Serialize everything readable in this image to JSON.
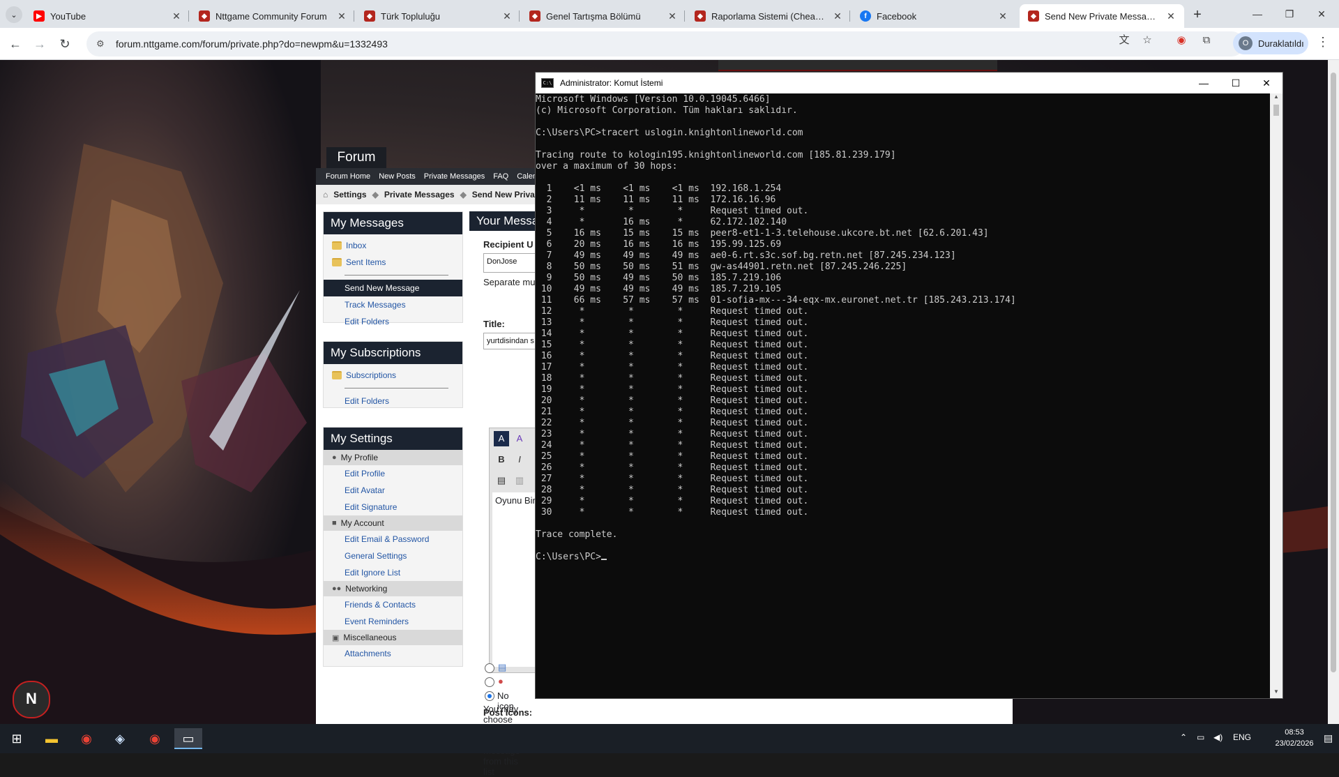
{
  "browser": {
    "tabs": [
      {
        "title": "YouTube",
        "icon": "youtube-icon",
        "color": "#ff0000"
      },
      {
        "title": "Nttgame Community Forum",
        "icon": "nttgame-icon",
        "color": "#b3261e"
      },
      {
        "title": "Türk Topluluğu",
        "icon": "nttgame-icon",
        "color": "#b3261e"
      },
      {
        "title": "Genel Tartışma Bölümü",
        "icon": "nttgame-icon",
        "color": "#b3261e"
      },
      {
        "title": "Raporlama Sistemi (Cheat Repo",
        "icon": "nttgame-icon",
        "color": "#b3261e"
      },
      {
        "title": "Facebook",
        "icon": "facebook-icon",
        "color": "#1877f2"
      },
      {
        "title": "Send New Private Message - N",
        "icon": "nttgame-icon",
        "color": "#b3261e",
        "active": true
      }
    ],
    "url": "forum.nttgame.com/forum/private.php?do=newpm&u=1332493",
    "profile_initial": "O",
    "profile_label": "Duraklatıldı"
  },
  "forum": {
    "tab_label": "Forum",
    "nav": [
      "Forum Home",
      "New Posts",
      "Private Messages",
      "FAQ",
      "Calenda"
    ],
    "breadcrumb": [
      "Settings",
      "Private Messages",
      "Send New Privat"
    ],
    "my_messages": {
      "title": "My Messages",
      "folders": [
        "Inbox",
        "Sent Items"
      ],
      "links": [
        "Send New Message",
        "Track Messages",
        "Edit Folders"
      ]
    },
    "my_subscriptions": {
      "title": "My Subscriptions",
      "folders": [
        "Subscriptions"
      ],
      "links": [
        "Edit Folders"
      ]
    },
    "my_settings": {
      "title": "My Settings",
      "groups": [
        {
          "label": "My Profile",
          "links": [
            "Edit Profile",
            "Edit Avatar",
            "Edit Signature"
          ]
        },
        {
          "label": "My Account",
          "links": [
            "Edit Email & Password",
            "General Settings",
            "Edit Ignore List"
          ]
        },
        {
          "label": "Networking",
          "links": [
            "Friends & Contacts",
            "Event Reminders"
          ]
        },
        {
          "label": "Miscellaneous",
          "links": [
            "Attachments"
          ]
        }
      ]
    },
    "compose": {
      "header": "Your Messa",
      "recipient_label": "Recipient U",
      "recipient_value": "DonJose",
      "separate_text": "Separate mu",
      "title_label": "Title:",
      "title_value": "yurtdisindan s",
      "body_text": "Oyunu Birl",
      "post_icons_label": "Post Icons:",
      "no_icon_label": "No icon",
      "icons_hint": "You may choose an icon for your message from this list"
    }
  },
  "cmd": {
    "title": "Administrator: Komut İstemi",
    "lines": [
      "Microsoft Windows [Version 10.0.19045.6466]",
      "(c) Microsoft Corporation. Tüm hakları saklıdır.",
      "",
      "C:\\Users\\PC>tracert uslogin.knightonlineworld.com",
      "",
      "Tracing route to kologin195.knightonlineworld.com [185.81.239.179]",
      "over a maximum of 30 hops:",
      "",
      "  1    <1 ms    <1 ms    <1 ms  192.168.1.254",
      "  2    11 ms    11 ms    11 ms  172.16.16.96",
      "  3     *        *        *     Request timed out.",
      "  4     *       16 ms     *     62.172.102.140",
      "  5    16 ms    15 ms    15 ms  peer8-et1-1-3.telehouse.ukcore.bt.net [62.6.201.43]",
      "  6    20 ms    16 ms    16 ms  195.99.125.69",
      "  7    49 ms    49 ms    49 ms  ae0-6.rt.s3c.sof.bg.retn.net [87.245.234.123]",
      "  8    50 ms    50 ms    51 ms  gw-as44901.retn.net [87.245.246.225]",
      "  9    50 ms    49 ms    50 ms  185.7.219.106",
      " 10    49 ms    49 ms    49 ms  185.7.219.105",
      " 11    66 ms    57 ms    57 ms  01-sofia-mx---34-eqx-mx.euronet.net.tr [185.243.213.174]",
      " 12     *        *        *     Request timed out.",
      " 13     *        *        *     Request timed out.",
      " 14     *        *        *     Request timed out.",
      " 15     *        *        *     Request timed out.",
      " 16     *        *        *     Request timed out.",
      " 17     *        *        *     Request timed out.",
      " 18     *        *        *     Request timed out.",
      " 19     *        *        *     Request timed out.",
      " 20     *        *        *     Request timed out.",
      " 21     *        *        *     Request timed out.",
      " 22     *        *        *     Request timed out.",
      " 23     *        *        *     Request timed out.",
      " 24     *        *        *     Request timed out.",
      " 25     *        *        *     Request timed out.",
      " 26     *        *        *     Request timed out.",
      " 27     *        *        *     Request timed out.",
      " 28     *        *        *     Request timed out.",
      " 29     *        *        *     Request timed out.",
      " 30     *        *        *     Request timed out.",
      "",
      "Trace complete.",
      "",
      "C:\\Users\\PC>"
    ]
  },
  "taskbar": {
    "apps": [
      "windows-start-icon",
      "file-explorer-icon",
      "chrome-icon",
      "steam-icon",
      "chrome-profile-icon",
      "terminal-icon"
    ],
    "lang": "ENG",
    "time": "08:53",
    "date": "23/02/2026"
  },
  "colors": {
    "forum_header": "#1b2330",
    "link": "#2255a4",
    "cmd_bg": "#0c0c0c",
    "cmd_text": "#cccccc"
  }
}
